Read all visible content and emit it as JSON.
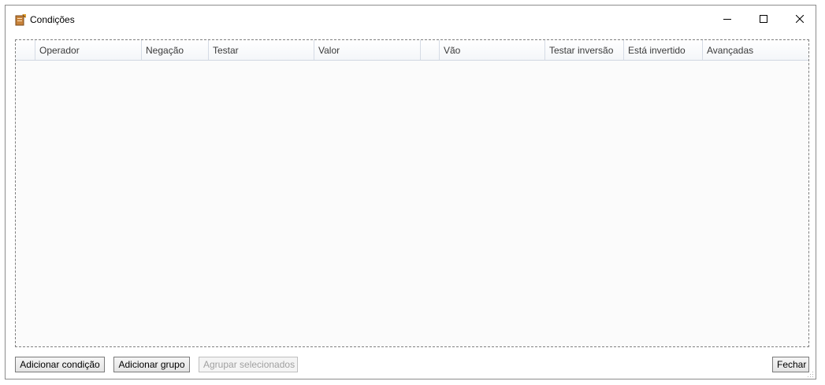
{
  "window": {
    "title": "Condições",
    "icon": "app-document-icon",
    "controls": {
      "minimize": "minimize-icon",
      "maximize": "maximize-icon",
      "close": "close-icon"
    }
  },
  "grid": {
    "columns": [
      {
        "id": "row-header",
        "label": ""
      },
      {
        "id": "operador",
        "label": "Operador"
      },
      {
        "id": "negacao",
        "label": "Negação"
      },
      {
        "id": "testar",
        "label": "Testar"
      },
      {
        "id": "valor",
        "label": "Valor"
      },
      {
        "id": "blank",
        "label": ""
      },
      {
        "id": "vao",
        "label": "Vão"
      },
      {
        "id": "testar-inversao",
        "label": "Testar inversão"
      },
      {
        "id": "esta-invertido",
        "label": "Está invertido"
      },
      {
        "id": "avancadas",
        "label": "Avançadas"
      }
    ],
    "rows": []
  },
  "buttons": {
    "add_condition": "Adicionar condição",
    "add_group": "Adicionar grupo",
    "group_selected": "Agrupar selecionados",
    "close": "Fechar"
  },
  "colors": {
    "grid_background": "#fbfbfb",
    "border": "#8c8c8c",
    "disabled_text": "#a0a0a0"
  }
}
